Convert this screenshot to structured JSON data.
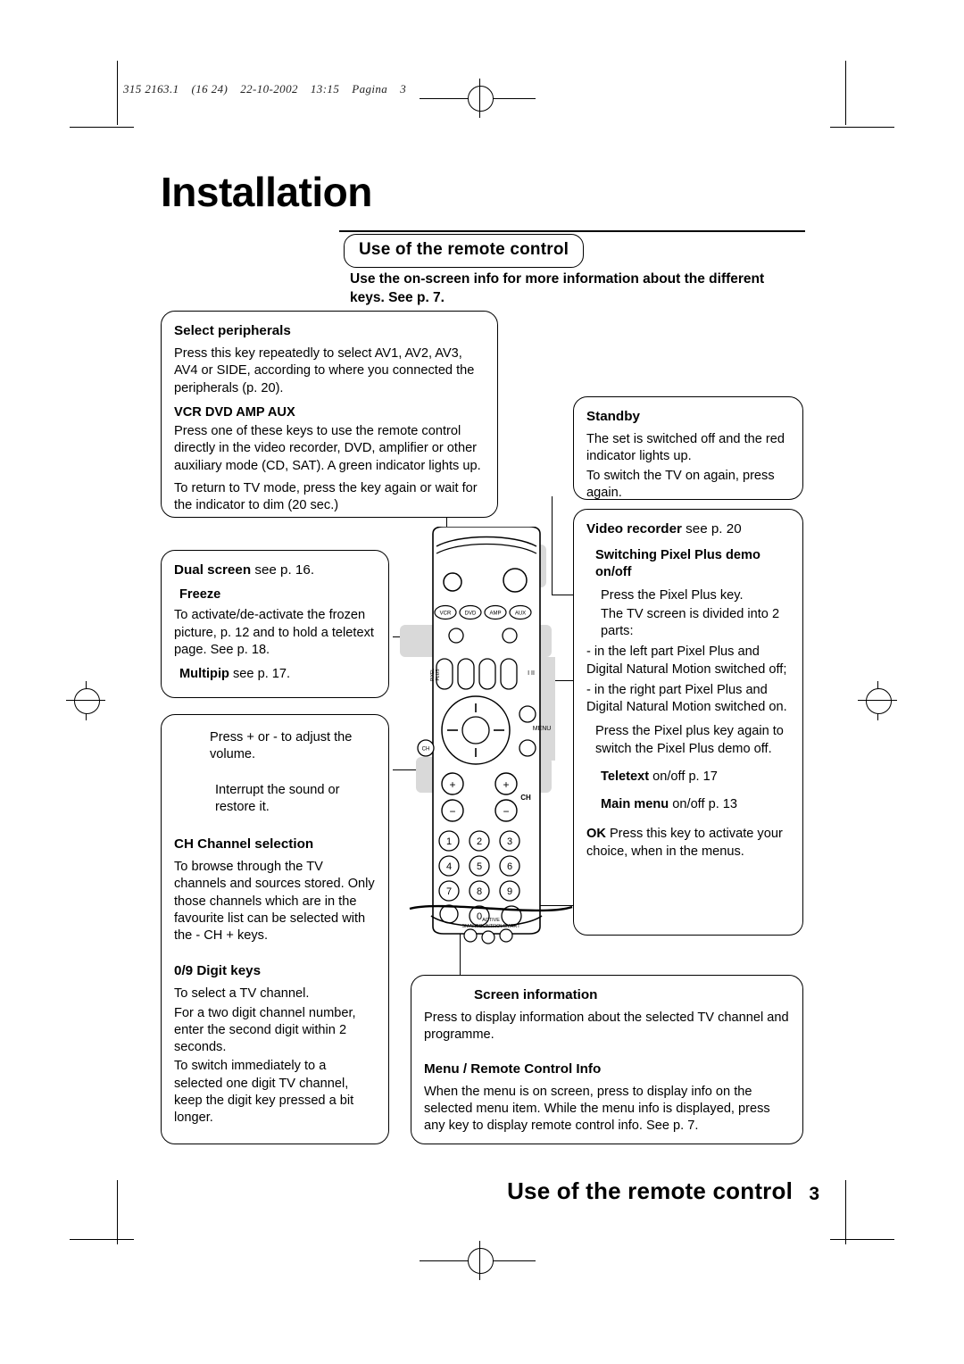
{
  "header": {
    "slug_parts": [
      "315  2163.1",
      "(16  24)",
      "22-10-2002",
      "13:15",
      "Pagina",
      "3"
    ]
  },
  "title": "Installation",
  "section_pill": "Use of the remote control",
  "intro": "Use the on-screen info for more information about the different keys. See p. 7.",
  "boxes": {
    "select_peripherals": {
      "heading": "Select peripherals",
      "p1": "Press this key repeatedly to select AV1, AV2, AV3, AV4 or SIDE, according to where you connected the peripherals (p. 20).",
      "subheading": "VCR  DVD  AMP  AUX",
      "p2": "Press one of these keys to use the remote control directly in the video recorder, DVD, amplifier or other auxiliary mode (CD, SAT). A green indicator lights up.",
      "p3": "To return to TV mode, press the key again or wait for the indicator to dim (20 sec.)"
    },
    "standby": {
      "heading": "Standby",
      "p1": "The set is switched off and the red indicator lights up.",
      "p2": "To switch the TV on again, press again."
    },
    "dual_screen": {
      "heading": "Dual screen",
      "heading_note": "see p. 16.",
      "subheading": "Freeze",
      "p1": "To activate/de-activate the frozen picture, p. 12 and to hold a teletext page. See p. 18.",
      "subheading2": "Multipip",
      "subheading2_note": "see p. 17."
    },
    "volume": {
      "p1": "Press + or - to adjust the volume.",
      "p2": "Interrupt the sound or restore it.",
      "heading": "CH   Channel selection",
      "p3": "To browse through the TV channels and sources stored. Only those channels which are in the favourite list can be selected with the - CH + keys.",
      "heading2": "0/9   Digit keys",
      "p4": "To select a TV channel.",
      "p5": "For a two digit channel number, enter the second digit within 2 seconds.",
      "p6": "To switch immediately to a selected one digit TV channel, keep the digit key pressed a bit longer."
    },
    "video_recorder": {
      "heading": "Video recorder",
      "heading_note": "see p. 20",
      "subheading": "Switching Pixel Plus demo on/off",
      "p1": "Press the Pixel Plus key.",
      "p2": "The TV screen is divided into 2 parts:",
      "p3": "- in the left part Pixel Plus and Digital Natural Motion switched off;",
      "p4": "- in the right part Pixel Plus and Digital Natural Motion switched on.",
      "p5": "Press the Pixel plus key again to switch the Pixel Plus demo off.",
      "teletext": "Teletext",
      "teletext_note": "on/off  p. 17",
      "mainmenu": "Main menu",
      "mainmenu_note": "on/off  p. 13",
      "ok": "OK",
      "ok_note": "Press this key to activate your choice, when in the menus."
    },
    "screen_information": {
      "heading": "Screen information",
      "p1": "Press to display information about the selected TV channel and programme.",
      "subheading": "Menu / Remote Control Info",
      "p2": "When the menu is on screen, press          to display info on the selected menu item. While the menu info is displayed, press any key to display remote control info. See p. 7."
    }
  },
  "remote": {
    "mode_keys": [
      "VCR",
      "DVD",
      "AMP",
      "AUX"
    ],
    "pixel_plus_label": "PIXEL PLUS",
    "menu_label": "MENU",
    "ch_label": "CH",
    "ch_left_label": "CH",
    "digits": [
      "1",
      "2",
      "3",
      "4",
      "5",
      "6",
      "7",
      "8",
      "9",
      "0"
    ],
    "active_label": "ACTIVE",
    "control_label": "SMARTCONTROLSMART"
  },
  "footer": {
    "title": "Use of the remote control",
    "page": "3"
  }
}
